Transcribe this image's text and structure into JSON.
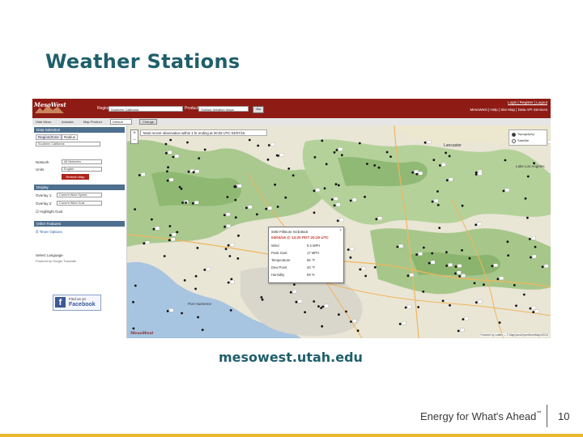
{
  "slide": {
    "title": "Weather Stations",
    "url": "mesowest.utah.edu",
    "footer_tagline": "Energy for What's Ahead",
    "footer_tagline_mark": "℠",
    "page_number": "10",
    "accent_color": "#1f5f6b",
    "stripe_color": "#e8b82f"
  },
  "app": {
    "logo": "MesoWest",
    "region_label": "Region",
    "region_value": "Southern California",
    "product_label": "Product",
    "product_value": "Surface Weather Maps",
    "go_label": "Go",
    "top_links": "MesoWest | Help | Site Map | Data API Services",
    "login": "Login | Register | Logout",
    "header_color": "#8e1b14",
    "subbar": {
      "hide_menu": "Hide Menu",
      "animate": "Animate",
      "map_product": "Map Product",
      "product_select": "Default",
      "change_btn": "Change"
    },
    "sidebar": {
      "data_selection": "Data Selection",
      "region_zone_tab": "Region/Zone",
      "radius_tab": "Radius",
      "region_select": "Southern California",
      "network_label": "Network",
      "network_value": "All Networks",
      "units_label": "Units",
      "units_value": "English",
      "refresh_btn": "Refresh Map",
      "display": "Display",
      "overlay1_label": "Overlay 1:",
      "overlay1_value": "Current Wind Speed",
      "overlay2_label": "Overlay 2:",
      "overlay2_value": "Current Wind Gust",
      "highlight_label": "Highlight Gust",
      "other_features": "Other Features",
      "timer_options": "Timer Options",
      "select_language": "Select Language",
      "powered_by": "Powered by Google Translate",
      "fb_find": "Find us on",
      "fb_name": "Facebook"
    },
    "map": {
      "obs_text": "Most recent observation within 1 hr ending at 20:26 UTC 04/07/16",
      "layer_topo": "Topography",
      "layer_sat": "Satellite",
      "cities": [
        "Lancaster",
        "Lake Los Angeles",
        "Port Hueneme"
      ],
      "map_logo": "MesoWest",
      "attribution": "Powered by Leaflet — © MapQuest/OpenStreetMap/USGS",
      "popup": {
        "station": "SOE Fillmore SCE4516",
        "datetime": "04/04/16 @ 13:20 PDT  20:20 UTC",
        "rows": [
          {
            "label": "Wind",
            "value": "9.3 MPH"
          },
          {
            "label": "Peak Gust",
            "value": "17 MPH"
          },
          {
            "label": "Temperature",
            "value": "55 °F"
          },
          {
            "label": "Dew Point",
            "value": "40 °F"
          },
          {
            "label": "Humidity",
            "value": "59 %"
          }
        ]
      }
    }
  }
}
